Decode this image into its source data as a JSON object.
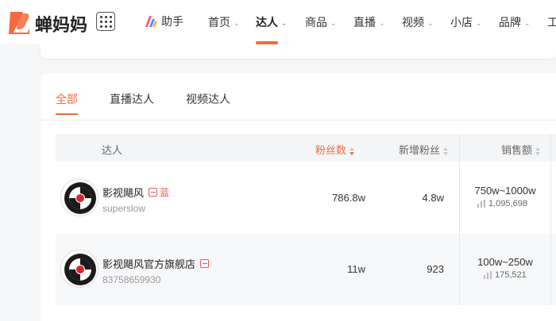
{
  "brand": {
    "name": "蝉妈妈",
    "accent": "#f36a3f"
  },
  "nav": {
    "assistant_label": "助手",
    "items": [
      {
        "label": "首页",
        "has_chevron": true
      },
      {
        "label": "达人",
        "has_chevron": true,
        "active": true
      },
      {
        "label": "商品",
        "has_chevron": true
      },
      {
        "label": "直播",
        "has_chevron": true
      },
      {
        "label": "视频",
        "has_chevron": true
      },
      {
        "label": "小店",
        "has_chevron": true
      },
      {
        "label": "品牌",
        "has_chevron": true
      },
      {
        "label": "工"
      }
    ]
  },
  "tabs": [
    {
      "label": "全部",
      "active": true
    },
    {
      "label": "直播达人"
    },
    {
      "label": "视频达人"
    }
  ],
  "table": {
    "columns": {
      "influencer": "达人",
      "fans": "粉丝数",
      "new_fans": "新增粉丝",
      "sales": "销售额"
    },
    "rows": [
      {
        "name": "影视飓风",
        "tag": "蓝",
        "handle": "superslow",
        "fans": "786.8w",
        "new_fans": "4.8w",
        "sales_range": "750w~1000w",
        "sales_count": "1,095,698"
      },
      {
        "name": "影视飓风官方旗舰店",
        "tag": "",
        "handle": "83758659930",
        "fans": "11w",
        "new_fans": "923",
        "sales_range": "100w~250w",
        "sales_count": "175,521"
      }
    ]
  }
}
